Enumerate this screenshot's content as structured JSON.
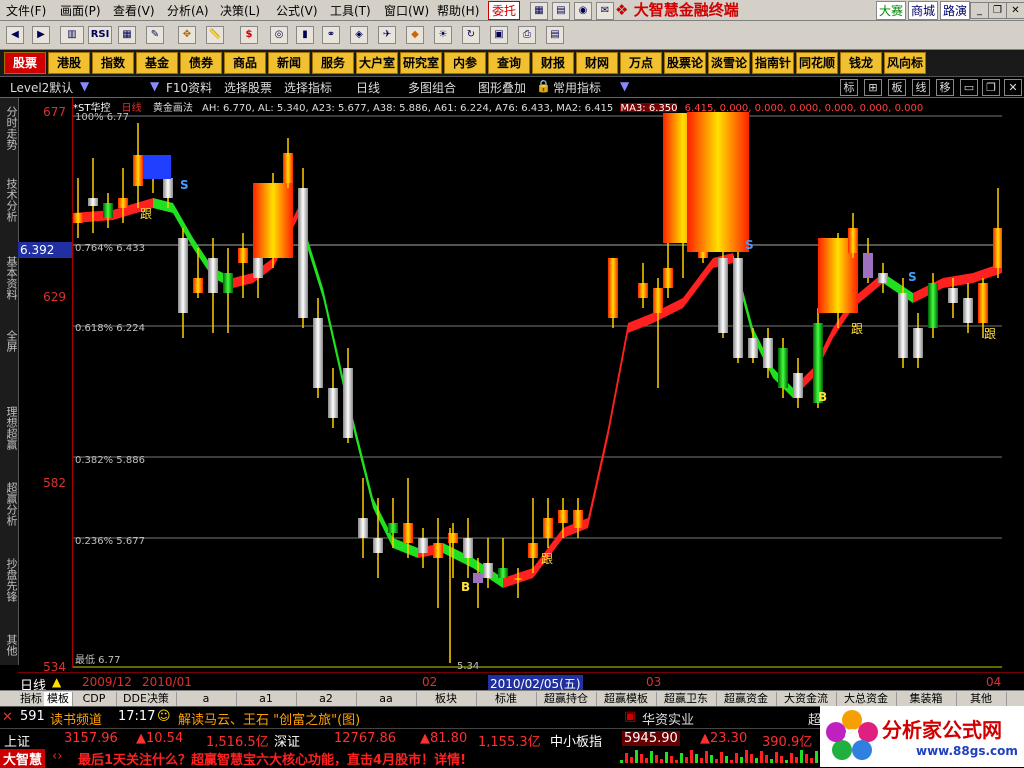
{
  "menubar": {
    "items": [
      "文件(F)",
      "画面(P)",
      "查看(V)",
      "分析(A)",
      "决策(L)",
      "公式(V)",
      "工具(T)",
      "窗口(W)",
      "帮助(H)"
    ],
    "entrust": "委托",
    "brand": "大智慧金融终端",
    "right_links": [
      "大赛",
      "商城",
      "路演"
    ]
  },
  "toolbar_icons": [
    "rsi-icon",
    "split-icon",
    "ruler-icon",
    "move-icon",
    "chart-bar-icon",
    "dollar-icon",
    "money-icon",
    "news-icon",
    "book-icon",
    "stock-icon",
    "gear-icon"
  ],
  "funcbar": {
    "buttons": [
      "股票",
      "港股",
      "指数",
      "基金",
      "债券",
      "商品",
      "新闻",
      "服务",
      "大户室",
      "研究室",
      "内参",
      "查询",
      "财报",
      "财网",
      "万点",
      "股票论",
      "淡雪论",
      "指南针",
      "同花顺",
      "钱龙",
      "风向标"
    ]
  },
  "toolbar2": {
    "level2": "Level2默认",
    "items": [
      "F10资料",
      "选择股票",
      "选择指标",
      "日线",
      "多图组合",
      "图形叠加",
      "常用指标"
    ],
    "right": [
      "标",
      "板",
      "线",
      "移"
    ]
  },
  "sidebar": {
    "tabs": [
      "分时走势",
      "技术分析",
      "基本资料",
      "全屏",
      "理想超赢",
      "超赢分析",
      "抄盘先锋",
      "其他"
    ]
  },
  "price_axis": {
    "labels": [
      "677",
      "629",
      "582",
      "534"
    ],
    "current": "6.392"
  },
  "info": {
    "stock": "*ST华控",
    "period": "日线",
    "method": "黄金画法",
    "values": "AH: 6.770, AL: 5.340, A23: 5.677, A38: 5.886, A61: 6.224, A76: 6.433, MA2: 6.415",
    "ma3": "MA3: 6.350",
    "tail": "6.415, 0.000, 0.000, 0.000, 0.000, 0.000, 0.000"
  },
  "fib": {
    "pct100": "100%  6.77",
    "pct764": "0.764%  6.433",
    "pct618": "0.618%  6.224",
    "pct382": "0.382%  5.886",
    "pct236": "0.236%  5.677",
    "low": "最低  6.77",
    "low2": "5.34"
  },
  "timeline": {
    "period": "日线",
    "dates": [
      "2009/12",
      "2010/01",
      "02",
      "03",
      "04"
    ],
    "selected": "2010/02/05(五)"
  },
  "tabs": [
    "指标",
    "模板",
    "CDP",
    "DDE决策",
    "a",
    "a1",
    "a2",
    "aa",
    "板块",
    "标准",
    "超赢持仓",
    "超赢模板",
    "超赢卫东",
    "超赢资金",
    "大资金流",
    "大总资金",
    "集装箱",
    "其他"
  ],
  "news": {
    "count": "591",
    "channel": "读书频道",
    "time": "17:17",
    "headline": "解读马云、王石 \"创富之旅\"(图)",
    "right": "华资实业",
    "right2": "超"
  },
  "status": {
    "sh_label": "上证",
    "sh_value": "3157.96",
    "sh_change": "▲10.54",
    "sh_amount": "1,516.5亿",
    "sz_label": "深证",
    "sz_value": "12767.86",
    "sz_change": "▲81.80",
    "sz_amount": "1,155.3亿",
    "sme_label": "中小板指",
    "sme_value": "5945.90",
    "sme_change": "▲23.30",
    "sme_amount": "390.9亿"
  },
  "ticker": {
    "brand": "大智慧",
    "text": "最后1天关注什么？超赢智慧宝六大核心功能，直击4月股市！详情!"
  },
  "logo": {
    "title": "分析家公式网",
    "url": "www.88gs.com"
  },
  "markers": {
    "s": "S",
    "b": "B",
    "follow": "跟"
  },
  "colors": {
    "up": "#ff2020",
    "down": "#20e020",
    "gold": "#f0c030",
    "axis": "#e03030"
  }
}
